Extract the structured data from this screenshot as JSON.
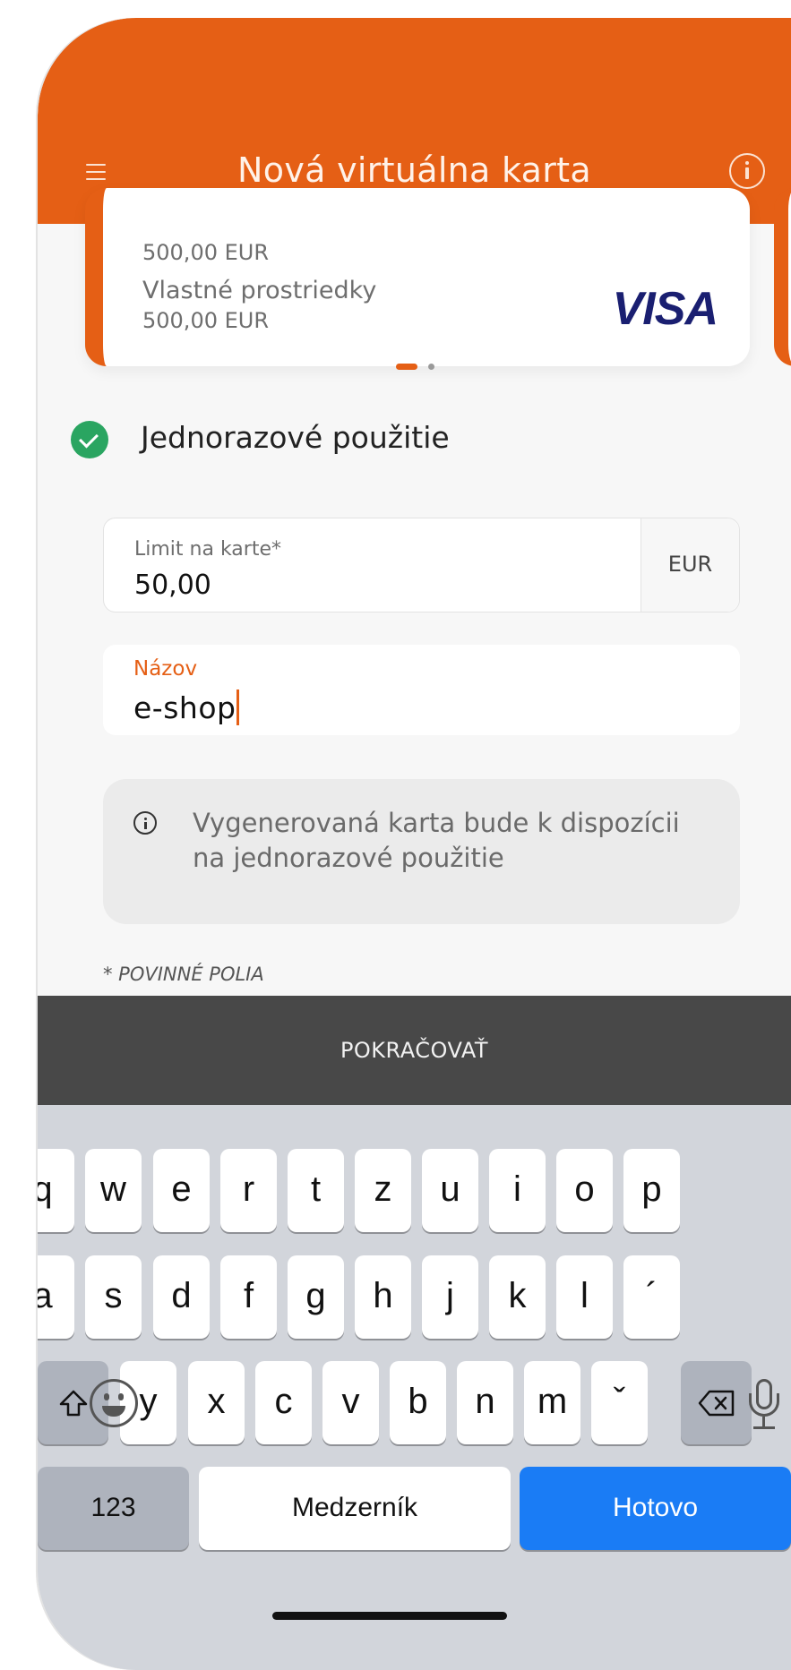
{
  "header": {
    "title": "Nová virtuálna karta"
  },
  "card": {
    "balance": "500,00 EUR",
    "funds_label": "Vlastné prostriedky",
    "funds_value": "500,00 EUR",
    "brand": "VISA"
  },
  "carousel": {
    "page": 1,
    "pages": 2
  },
  "option": {
    "label": "Jednorazové použitie",
    "selected": true
  },
  "limit_field": {
    "label": "Limit na karte*",
    "value": "50,00",
    "currency": "EUR"
  },
  "name_field": {
    "label": "Názov",
    "value": "e-shop"
  },
  "info_box": {
    "text": "Vygenerovaná karta bude k dispozícii na jednorazové použitie"
  },
  "required_note": "* POVINNÉ POLIA",
  "continue_button": {
    "label": "POKRAČOVAŤ"
  },
  "keyboard": {
    "row1": [
      "q",
      "w",
      "e",
      "r",
      "t",
      "z",
      "u",
      "i",
      "o",
      "p"
    ],
    "row2": [
      "a",
      "s",
      "d",
      "f",
      "g",
      "h",
      "j",
      "k",
      "l",
      "´"
    ],
    "row3": [
      "y",
      "x",
      "c",
      "v",
      "b",
      "n",
      "m",
      "ˇ"
    ],
    "numbers_key": "123",
    "space_key": "Medzerník",
    "done_key": "Hotovo"
  },
  "colors": {
    "accent": "#e55f15",
    "success": "#2aa561",
    "keyboard_action": "#1a7cf5",
    "button_bg": "#484848"
  }
}
